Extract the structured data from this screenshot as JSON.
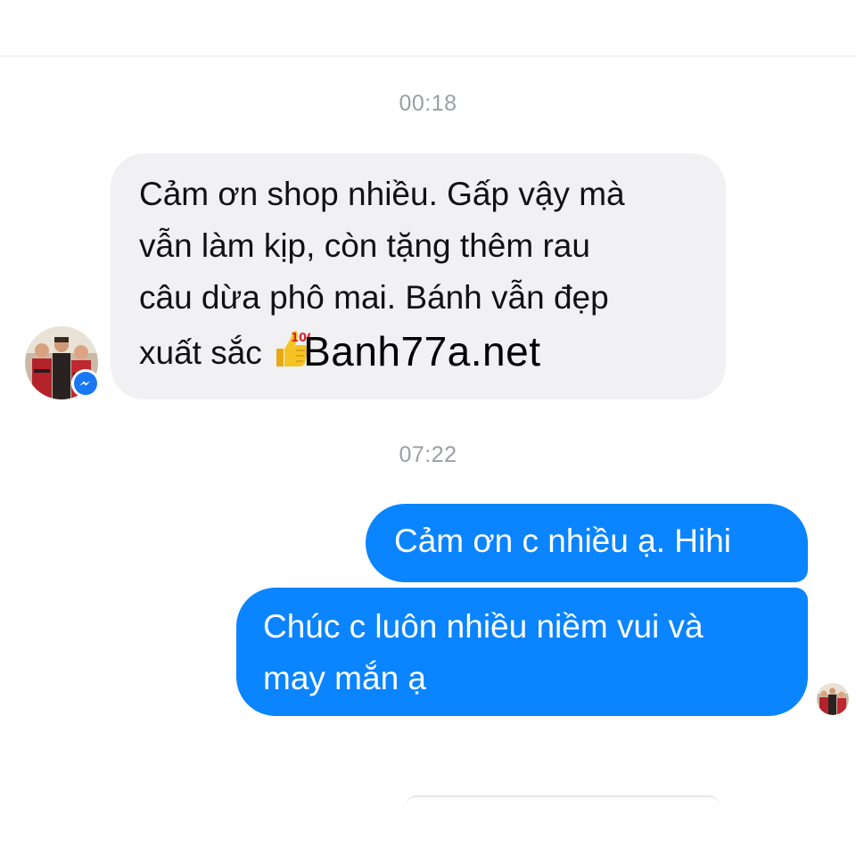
{
  "conversation": {
    "timestamps": [
      "00:18",
      "07:22"
    ],
    "incoming_message": {
      "lines": [
        "Cảm ơn shop nhiều. Gấp vậy mà",
        "vẫn làm kịp, còn tặng thêm rau",
        "câu dừa phô mai. Bánh vẫn đẹp",
        "xuất sắc"
      ],
      "emoji": "thumbs-up-100-icon",
      "watermark": "Banh77a.net"
    },
    "outgoing_messages": [
      {
        "lines": [
          "Cảm ơn c nhiều ạ. Hihi"
        ]
      },
      {
        "lines": [
          "Chúc c luôn nhiều niềm vui và",
          "may mắn ạ"
        ]
      }
    ]
  },
  "colors": {
    "outgoing_bubble": "#0a84ff",
    "incoming_bubble": "#f1f1f3",
    "timestamp_text": "#9b9ea3",
    "messenger_badge": "#1877f2"
  },
  "icons": {
    "contact_avatar": "contact-avatar-icon",
    "messenger_badge": "messenger-icon",
    "own_avatar": "read-receipt-avatar-icon"
  }
}
